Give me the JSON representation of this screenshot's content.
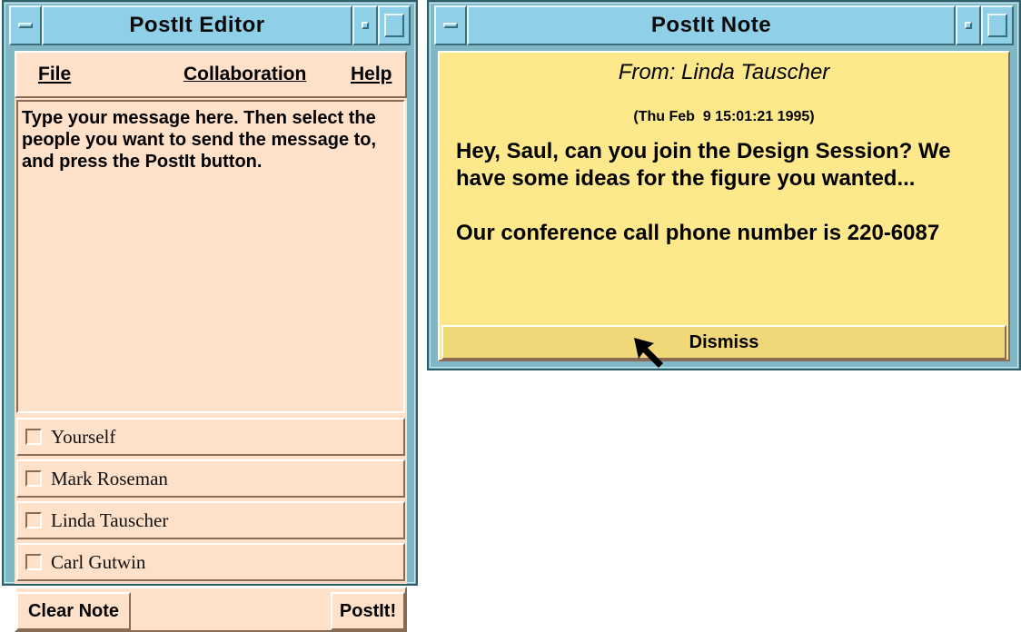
{
  "editor": {
    "title": "PostIt Editor",
    "menu": {
      "file": "File",
      "collaboration": "Collaboration",
      "help": "Help"
    },
    "message": "Type your message here. Then select the people you want to send the message to, and press the PostIt button.",
    "recipients": [
      {
        "name": "Yourself",
        "checked": false
      },
      {
        "name": "Mark Roseman",
        "checked": false
      },
      {
        "name": "Linda Tauscher",
        "checked": false
      },
      {
        "name": "Carl Gutwin",
        "checked": false
      }
    ],
    "clear_button": "Clear Note",
    "postit_button": "PostIt!"
  },
  "note": {
    "title": "PostIt Note",
    "from": "From: Linda Tauscher",
    "timestamp": "(Thu Feb  9 15:01:21 1995)",
    "message": "Hey, Saul, can you join the Design Session? We have some ideas for the figure you wanted...\n\nOur conference call phone number is 220-6087",
    "dismiss_button": "Dismiss"
  },
  "colors": {
    "frame": "#7fb7c4",
    "titlebar": "#8fd0e8",
    "editor_bg": "#ffe0c8",
    "note_bg": "#fde98c"
  }
}
